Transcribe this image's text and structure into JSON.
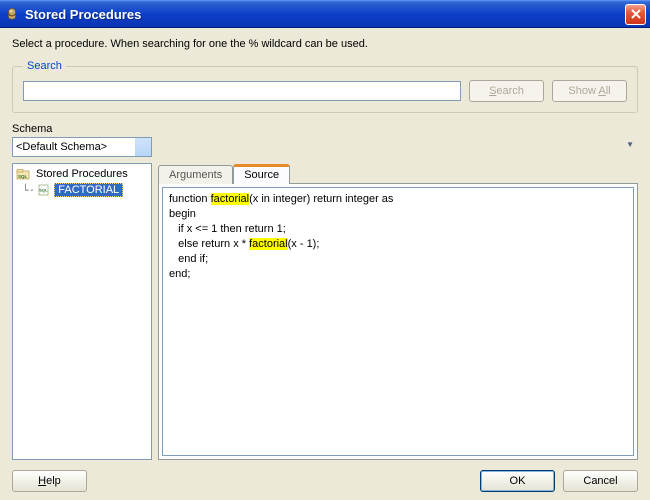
{
  "window": {
    "title": "Stored Procedures"
  },
  "instruction": "Select a procedure. When searching for one the % wildcard can be used.",
  "search": {
    "legend": "Search",
    "value": "",
    "search_btn": "Search",
    "show_all_btn": "Show All"
  },
  "schema": {
    "label": "Schema",
    "selected": "<Default Schema>"
  },
  "tree": {
    "root_label": "Stored Procedures",
    "items": [
      "FACTORIAL"
    ]
  },
  "tabs": {
    "arguments": "Arguments",
    "source": "Source"
  },
  "source": {
    "line1_a": "function ",
    "line1_hl": "factorial",
    "line1_b": "(x in integer) return integer as",
    "line2": "begin",
    "line3": "   if x <= 1 then return 1;",
    "line4_a": "   else return x * ",
    "line4_hl": "factorial",
    "line4_b": "(x - 1);",
    "line5": "   end if;",
    "line6": "end;"
  },
  "buttons": {
    "help": "Help",
    "ok": "OK",
    "cancel": "Cancel"
  },
  "chart_data": null
}
